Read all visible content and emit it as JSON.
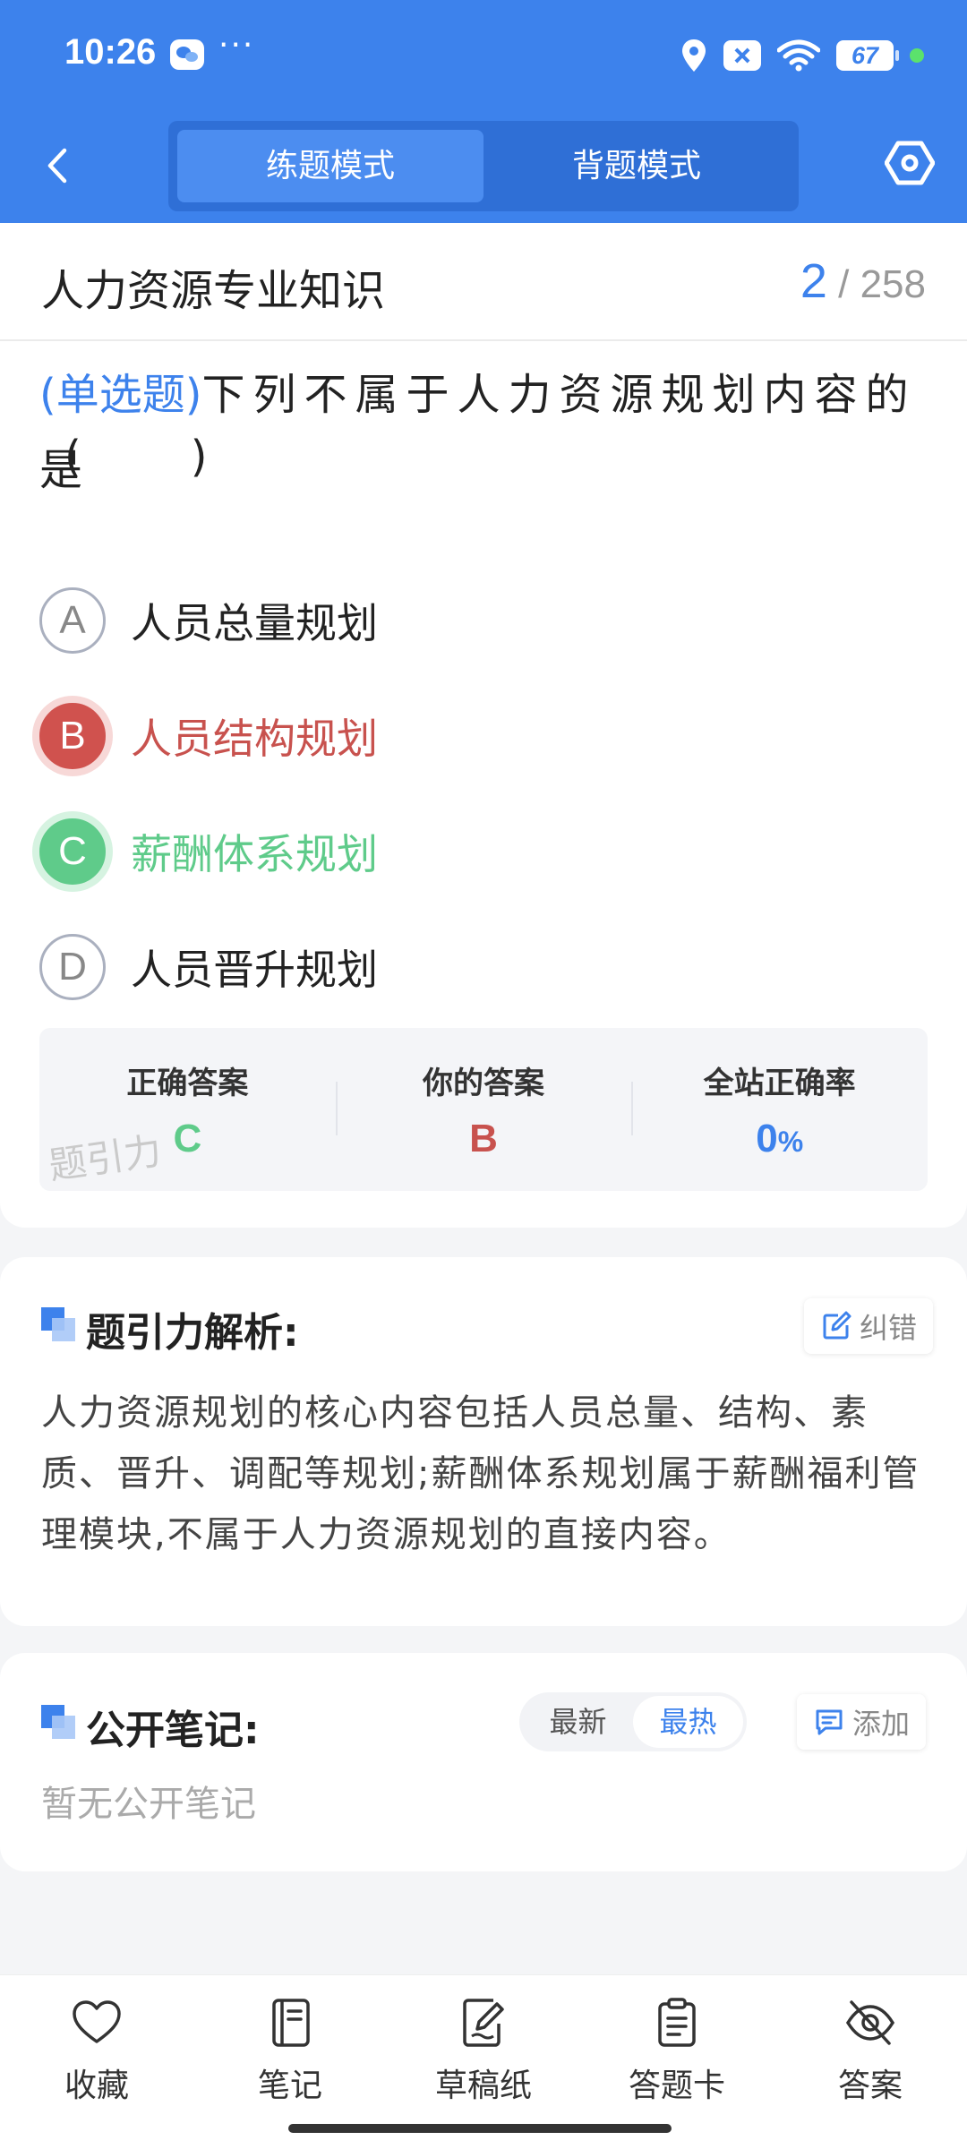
{
  "status_bar": {
    "time": "10:26",
    "dots": "···",
    "battery": "67",
    "icons": [
      "wechat-icon",
      "more-dots-icon",
      "location-icon",
      "blocked-notification-icon",
      "wifi-icon",
      "battery-icon"
    ]
  },
  "header": {
    "back_icon": "chevron-left-icon",
    "tabs": [
      {
        "label": "练题模式",
        "active": true
      },
      {
        "label": "背题模式",
        "active": false
      }
    ],
    "settings_icon": "hexagon-settings-icon",
    "colors": {
      "primary": "#3d82ec"
    }
  },
  "question": {
    "subject": "人力资源专业知识",
    "current": "2",
    "total": "/ 258",
    "type_tag": "(单选题)",
    "text": "下列不属于人力资源规划内容的是",
    "blank": "(        )",
    "options": [
      {
        "letter": "A",
        "text": "人员总量规划",
        "state": "normal"
      },
      {
        "letter": "B",
        "text": "人员结构规划",
        "state": "wrong"
      },
      {
        "letter": "C",
        "text": "薪酬体系规划",
        "state": "correct"
      },
      {
        "letter": "D",
        "text": "人员晋升规划",
        "state": "normal"
      }
    ],
    "answer_summary": {
      "correct_label": "正确答案",
      "correct_value": "C",
      "yours_label": "你的答案",
      "yours_value": "B",
      "rate_label": "全站正确率",
      "rate_value": "0",
      "rate_unit": "%",
      "watermark": "题引力"
    },
    "colors": {
      "wrong": "#d0524e",
      "correct": "#5fcb8a"
    }
  },
  "analysis": {
    "title": "题引力解析:",
    "report_label": "纠错",
    "text": "人力资源规划的核心内容包括人员总量、结构、素质、晋升、调配等规划;薪酬体系规划属于薪酬福利管理模块,不属于人力资源规划的直接内容。"
  },
  "notes": {
    "title": "公开笔记:",
    "sort_options": [
      {
        "label": "最新",
        "active": false
      },
      {
        "label": "最热",
        "active": true
      }
    ],
    "add_label": "添加",
    "empty_text": "暂无公开笔记"
  },
  "bottom_bar": {
    "items": [
      {
        "label": "收藏",
        "icon": "heart-icon"
      },
      {
        "label": "笔记",
        "icon": "notebook-icon"
      },
      {
        "label": "草稿纸",
        "icon": "draft-paper-icon"
      },
      {
        "label": "答题卡",
        "icon": "answer-sheet-icon"
      },
      {
        "label": "答案",
        "icon": "eye-off-icon"
      }
    ]
  }
}
